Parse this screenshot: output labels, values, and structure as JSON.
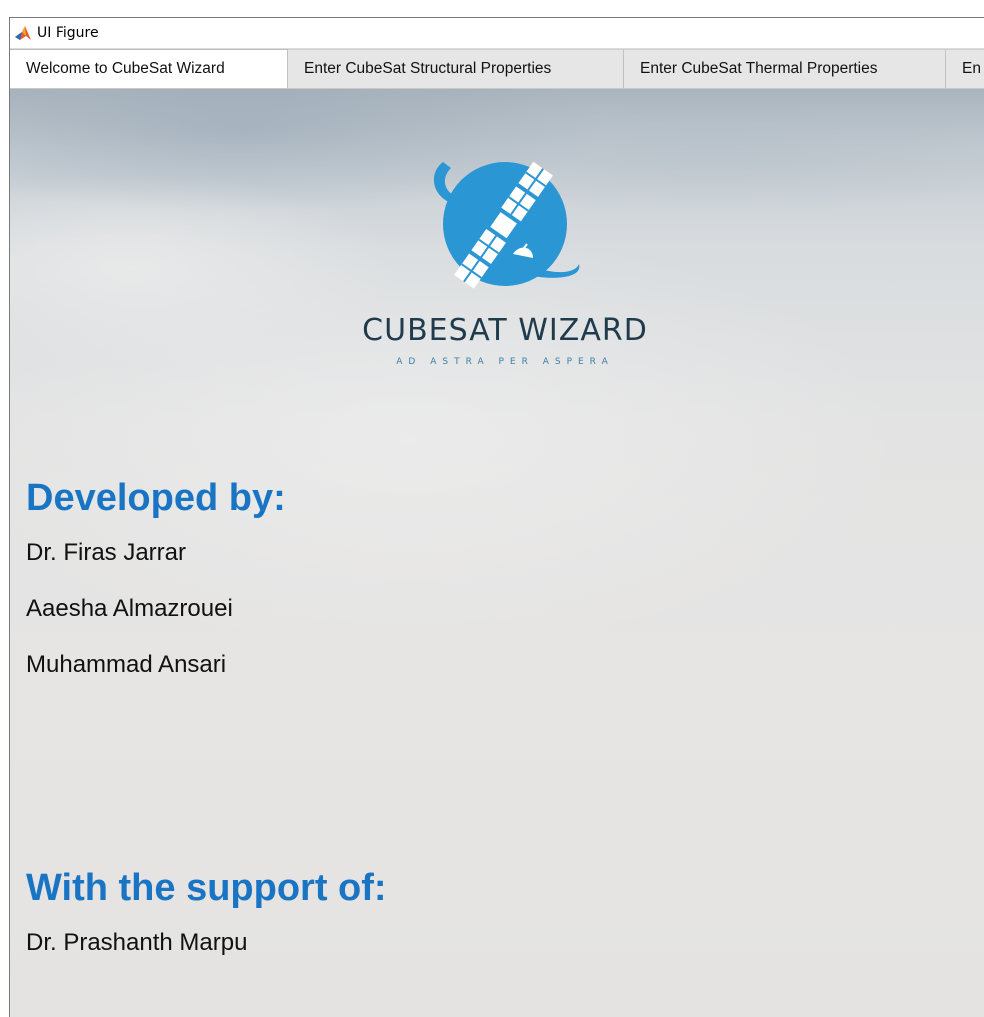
{
  "window": {
    "title": "UI Figure",
    "icon": "matlab-icon"
  },
  "tabs": [
    {
      "label": "Welcome to CubeSat Wizard",
      "active": true
    },
    {
      "label": "Enter CubeSat Structural Properties",
      "active": false
    },
    {
      "label": "Enter CubeSat Thermal Properties",
      "active": false
    },
    {
      "label": "En",
      "active": false
    }
  ],
  "welcome": {
    "logo_icon": "satellite-globe-icon",
    "brand_name": "CUBESAT WIZARD",
    "tagline": "AD ASTRA PER ASPERA",
    "developed_heading": "Developed by:",
    "developers": [
      "Dr. Firas Jarrar",
      "Aaesha Almazrouei",
      "Muhammad Ansari"
    ],
    "support_heading": "With the support of:",
    "supporters": [
      "Dr. Prashanth Marpu"
    ]
  },
  "colors": {
    "heading_blue": "#1a74c4",
    "logo_blue": "#2a96d4",
    "brand_navy": "#1f3b4c"
  }
}
